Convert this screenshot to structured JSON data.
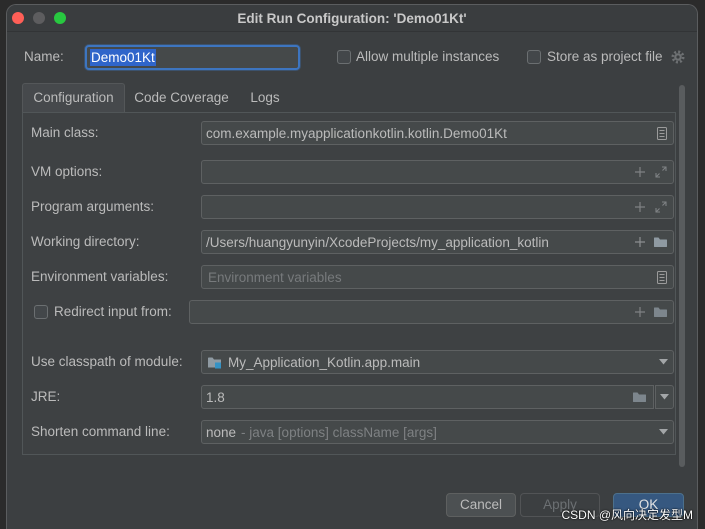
{
  "window": {
    "title": "Edit Run Configuration: 'Demo01Kt'",
    "controls": [
      "close-icon",
      "minimize-icon",
      "zoom-icon"
    ]
  },
  "header": {
    "name_label": "Name:",
    "name_value": "Demo01Kt",
    "allow_multiple_instances": {
      "label": "Allow multiple instances",
      "checked": false
    },
    "store_as_project_file": {
      "label": "Store as project file",
      "checked": false,
      "icon": "gear-icon"
    }
  },
  "tabs": [
    {
      "label": "Configuration",
      "selected": true
    },
    {
      "label": "Code Coverage",
      "selected": false
    },
    {
      "label": "Logs",
      "selected": false
    }
  ],
  "configuration": {
    "main_class": {
      "label": "Main class:",
      "value": "com.example.myapplicationkotlin.kotlin.Demo01Kt",
      "icons": [
        "document-icon"
      ]
    },
    "vm_options": {
      "label": "VM options:",
      "value": "",
      "icons": [
        "plus-icon",
        "expand-icon"
      ]
    },
    "program_arguments": {
      "label": "Program arguments:",
      "value": "",
      "icons": [
        "plus-icon",
        "expand-icon"
      ]
    },
    "working_directory": {
      "label": "Working directory:",
      "value": "/Users/huangyunyin/XcodeProjects/my_application_kotlin",
      "icons": [
        "plus-icon",
        "folder-icon"
      ]
    },
    "environment_variables": {
      "label": "Environment variables:",
      "value": "",
      "placeholder": "Environment variables",
      "icons": [
        "document-icon"
      ]
    },
    "redirect_input": {
      "label": "Redirect input from:",
      "checked": false,
      "value": "",
      "icons": [
        "plus-icon",
        "folder-icon"
      ]
    },
    "classpath_module": {
      "label": "Use classpath of module:",
      "value": "My_Application_Kotlin.app.main",
      "icons": [
        "module-icon",
        "chevron-down-icon"
      ]
    },
    "jre": {
      "label": "JRE:",
      "value": "1.8",
      "icons": [
        "folder-icon",
        "chevron-down-icon"
      ]
    },
    "shorten_command_line": {
      "label": "Shorten command line:",
      "value": "none",
      "hint": "- java [options] className [args]",
      "icons": [
        "chevron-down-icon"
      ]
    }
  },
  "footer": {
    "cancel_label": "Cancel",
    "apply_label": "Apply",
    "apply_enabled": false,
    "ok_label": "OK"
  },
  "watermark": "CSDN @风向决定发型M",
  "colors": {
    "accent": "#365880",
    "selection": "#2f65ca",
    "close": "#ff5f57",
    "minimize": "#5d5d5f",
    "zoom": "#28c840"
  }
}
